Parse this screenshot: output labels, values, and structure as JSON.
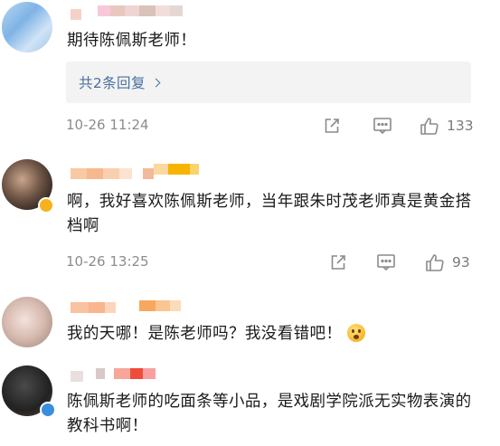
{
  "comments": [
    {
      "text": "期待陈佩斯老师！",
      "reply_label": "共2条回复",
      "timestamp": "10-26 11:24",
      "likes": "133"
    },
    {
      "text": "啊，我好喜欢陈佩斯老师，当年跟朱时茂老师真是黄金搭档啊",
      "timestamp": "10-26 13:25",
      "likes": "93"
    },
    {
      "text": "我的天哪！是陈老师吗？我没看错吧！"
    },
    {
      "text": "陈佩斯老师的吃面条等小品，是戏剧学院派无实物表演的教科书啊！"
    }
  ],
  "colors": {
    "link_blue": "#4a6f9e",
    "meta_gray": "#8c8c8c",
    "reply_bg": "#f3f3f3"
  }
}
